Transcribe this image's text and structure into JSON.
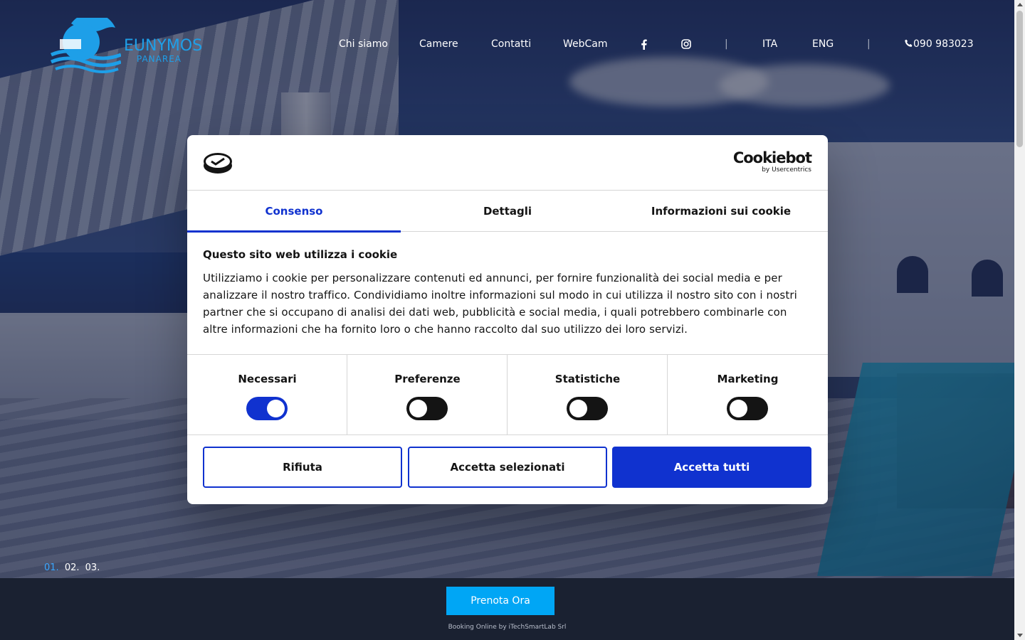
{
  "hero": {
    "slides": [
      "01.",
      "02.",
      "03."
    ]
  },
  "header": {
    "logo_text": "EUNYMOS",
    "logo_sub": "PANAREA",
    "nav": [
      "Chi siamo",
      "Camere",
      "Contatti",
      "WebCam"
    ],
    "social_icons": [
      "facebook-icon",
      "instagram-icon"
    ],
    "separator": "|",
    "languages": [
      "ITA",
      "ENG"
    ],
    "phone_icon": "phone-icon",
    "phone": "090 983023"
  },
  "booking": {
    "button": "Prenota Ora",
    "credit": "Booking Online by iTechSmartLab Srl"
  },
  "cookie_dialog": {
    "brand": "Cookiebot",
    "brand_sub": "by Usercentrics",
    "tabs": [
      "Consenso",
      "Dettagli",
      "Informazioni sui cookie"
    ],
    "active_tab": "Consenso",
    "title": "Questo sito web utilizza i cookie",
    "text": "Utilizziamo i cookie per personalizzare contenuti ed annunci, per fornire funzionalità dei social media e per analizzare il nostro traffico. Condividiamo inoltre informazioni sul modo in cui utilizza il nostro sito con i nostri partner che si occupano di analisi dei dati web, pubblicità e social media, i quali potrebbero combinarle con altre informazioni che ha fornito loro o che hanno raccolto dal suo utilizzo dei loro servizi.",
    "categories": [
      {
        "label": "Necessari",
        "enabled": true
      },
      {
        "label": "Preferenze",
        "enabled": false
      },
      {
        "label": "Statistiche",
        "enabled": false
      },
      {
        "label": "Marketing",
        "enabled": false
      }
    ],
    "buttons": {
      "reject": "Rifiuta",
      "accept_selected": "Accetta selezionati",
      "accept_all": "Accetta tutti"
    },
    "colors": {
      "accent": "#1032cf"
    }
  },
  "colors": {
    "brand": "#1e9fe8",
    "booking": "#00a6f5",
    "booking_bar": "#1a2131"
  }
}
